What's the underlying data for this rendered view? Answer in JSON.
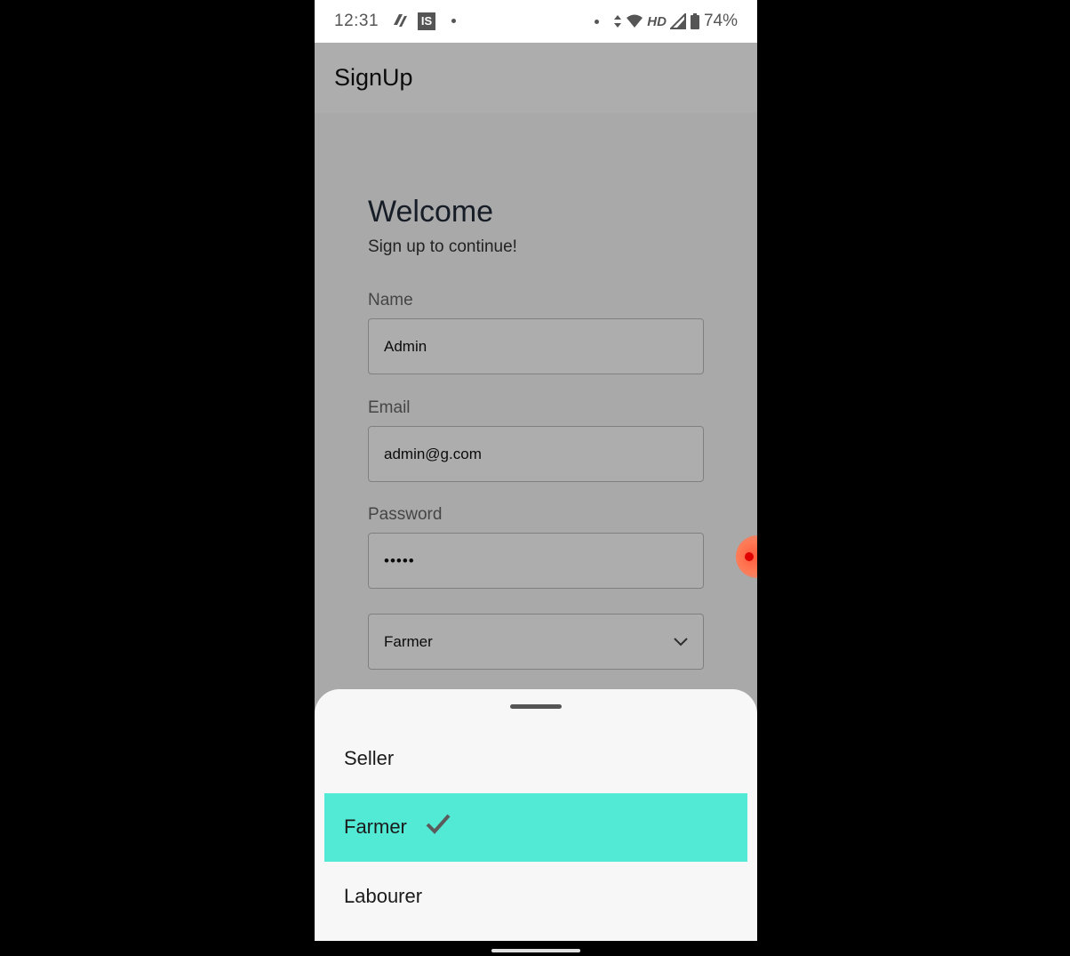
{
  "status_bar": {
    "time": "12:31",
    "app_icon_2": "IS",
    "network": "HD",
    "battery": "74%"
  },
  "app_bar": {
    "title": "SignUp"
  },
  "form": {
    "heading": "Welcome",
    "subheading": "Sign up to continue!",
    "name_label": "Name",
    "name_value": "Admin",
    "email_label": "Email",
    "email_value": "admin@g.com",
    "password_label": "Password",
    "password_value": "•••••",
    "role_value": "Farmer"
  },
  "sheet": {
    "options": [
      {
        "label": "Seller",
        "selected": false
      },
      {
        "label": "Farmer",
        "selected": true
      },
      {
        "label": "Labourer",
        "selected": false
      }
    ]
  },
  "colors": {
    "selected_highlight": "#52e9d5",
    "bubble": "#ff5b3d"
  },
  "icons": [
    "signal-sync-icon",
    "wifi-icon",
    "cell-signal-icon",
    "battery-icon",
    "chevron-down-icon",
    "checkmark-icon"
  ]
}
